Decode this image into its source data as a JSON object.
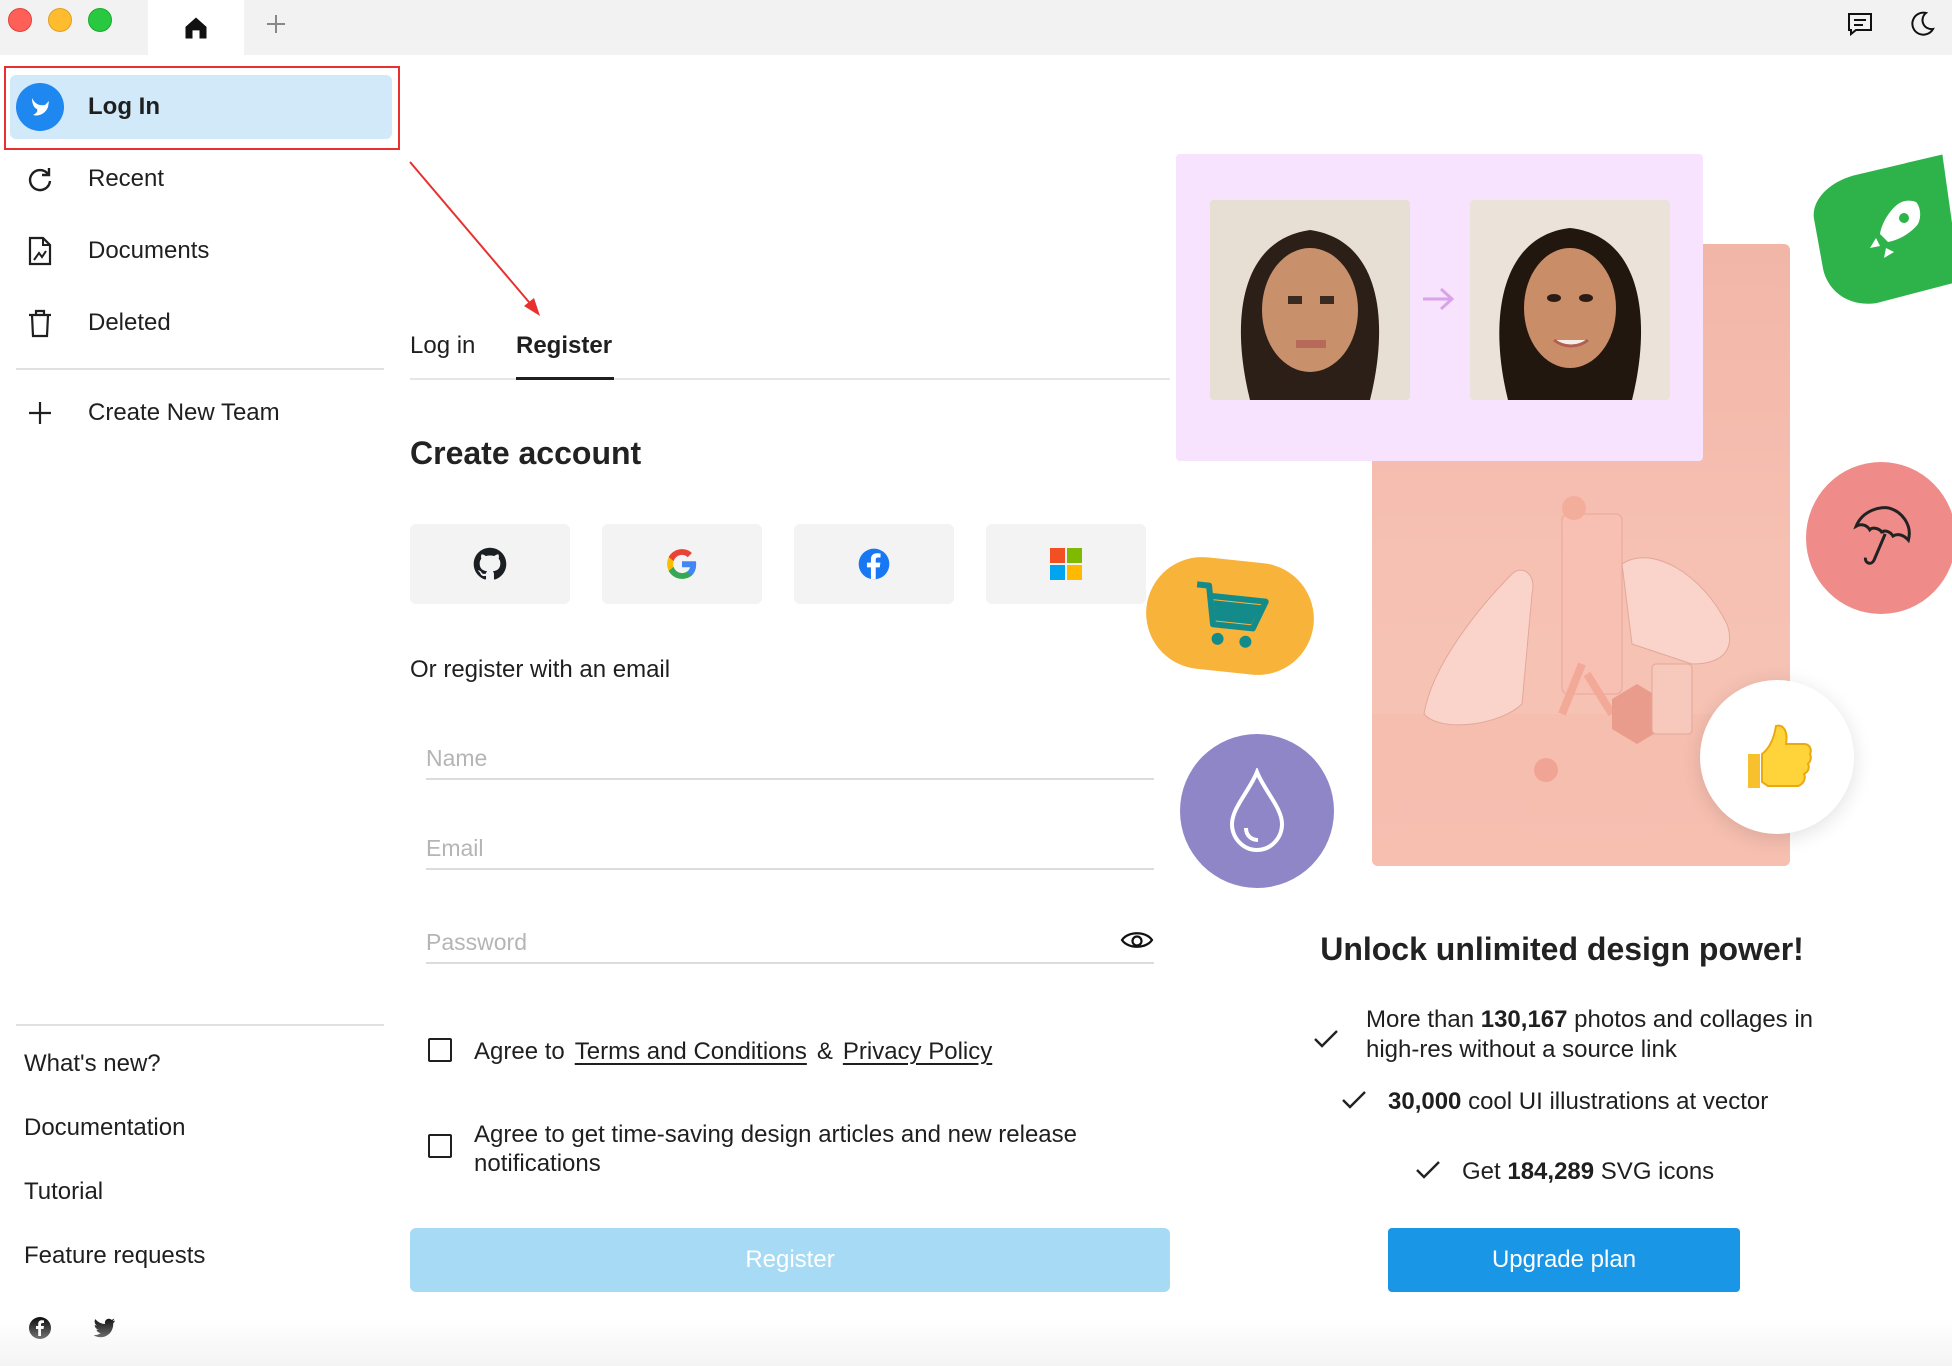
{
  "titlebar": {
    "home_icon": "home-icon",
    "new_tab_icon": "plus-icon",
    "chat_icon": "chat-icon",
    "theme_icon": "moon-icon"
  },
  "sidebar": {
    "login_label": "Log In",
    "items": [
      {
        "label": "Recent",
        "icon": "refresh-icon"
      },
      {
        "label": "Documents",
        "icon": "document-icon"
      },
      {
        "label": "Deleted",
        "icon": "trash-icon"
      }
    ],
    "create_team_label": "Create New Team",
    "footer_links": [
      "What's new?",
      "Documentation",
      "Tutorial",
      "Feature requests"
    ],
    "social": [
      "facebook-icon",
      "twitter-icon"
    ]
  },
  "auth": {
    "tab_login": "Log in",
    "tab_register": "Register",
    "title": "Create account",
    "sso_providers": [
      "github",
      "google",
      "facebook",
      "microsoft"
    ],
    "or_text": "Or register with an email",
    "name_placeholder": "Name",
    "email_placeholder": "Email",
    "password_placeholder": "Password",
    "agree_prefix": "Agree to",
    "terms_link": "Terms and Conditions",
    "amp": "&",
    "privacy_link": "Privacy Policy",
    "newsletter": "Agree to get time-saving design articles and new release notifications",
    "register_button": "Register"
  },
  "promo": {
    "title": "Unlock unlimited design power!",
    "features": [
      {
        "pre": "More than",
        "bold": "130,167",
        "post": "photos and collages in high-res without a source link"
      },
      {
        "pre": "",
        "bold": "30,000",
        "post": "cool UI illustrations at vector"
      },
      {
        "pre": "Get",
        "bold": "184,289",
        "post": "SVG icons"
      }
    ],
    "upgrade_button": "Upgrade plan"
  },
  "colors": {
    "accent": "#1a96e6",
    "login_highlight_bg": "#d1e9f9",
    "annotation": "#e8312f",
    "register_disabled": "#a7daf5",
    "promo_card_bg": "#f7e3fd"
  }
}
